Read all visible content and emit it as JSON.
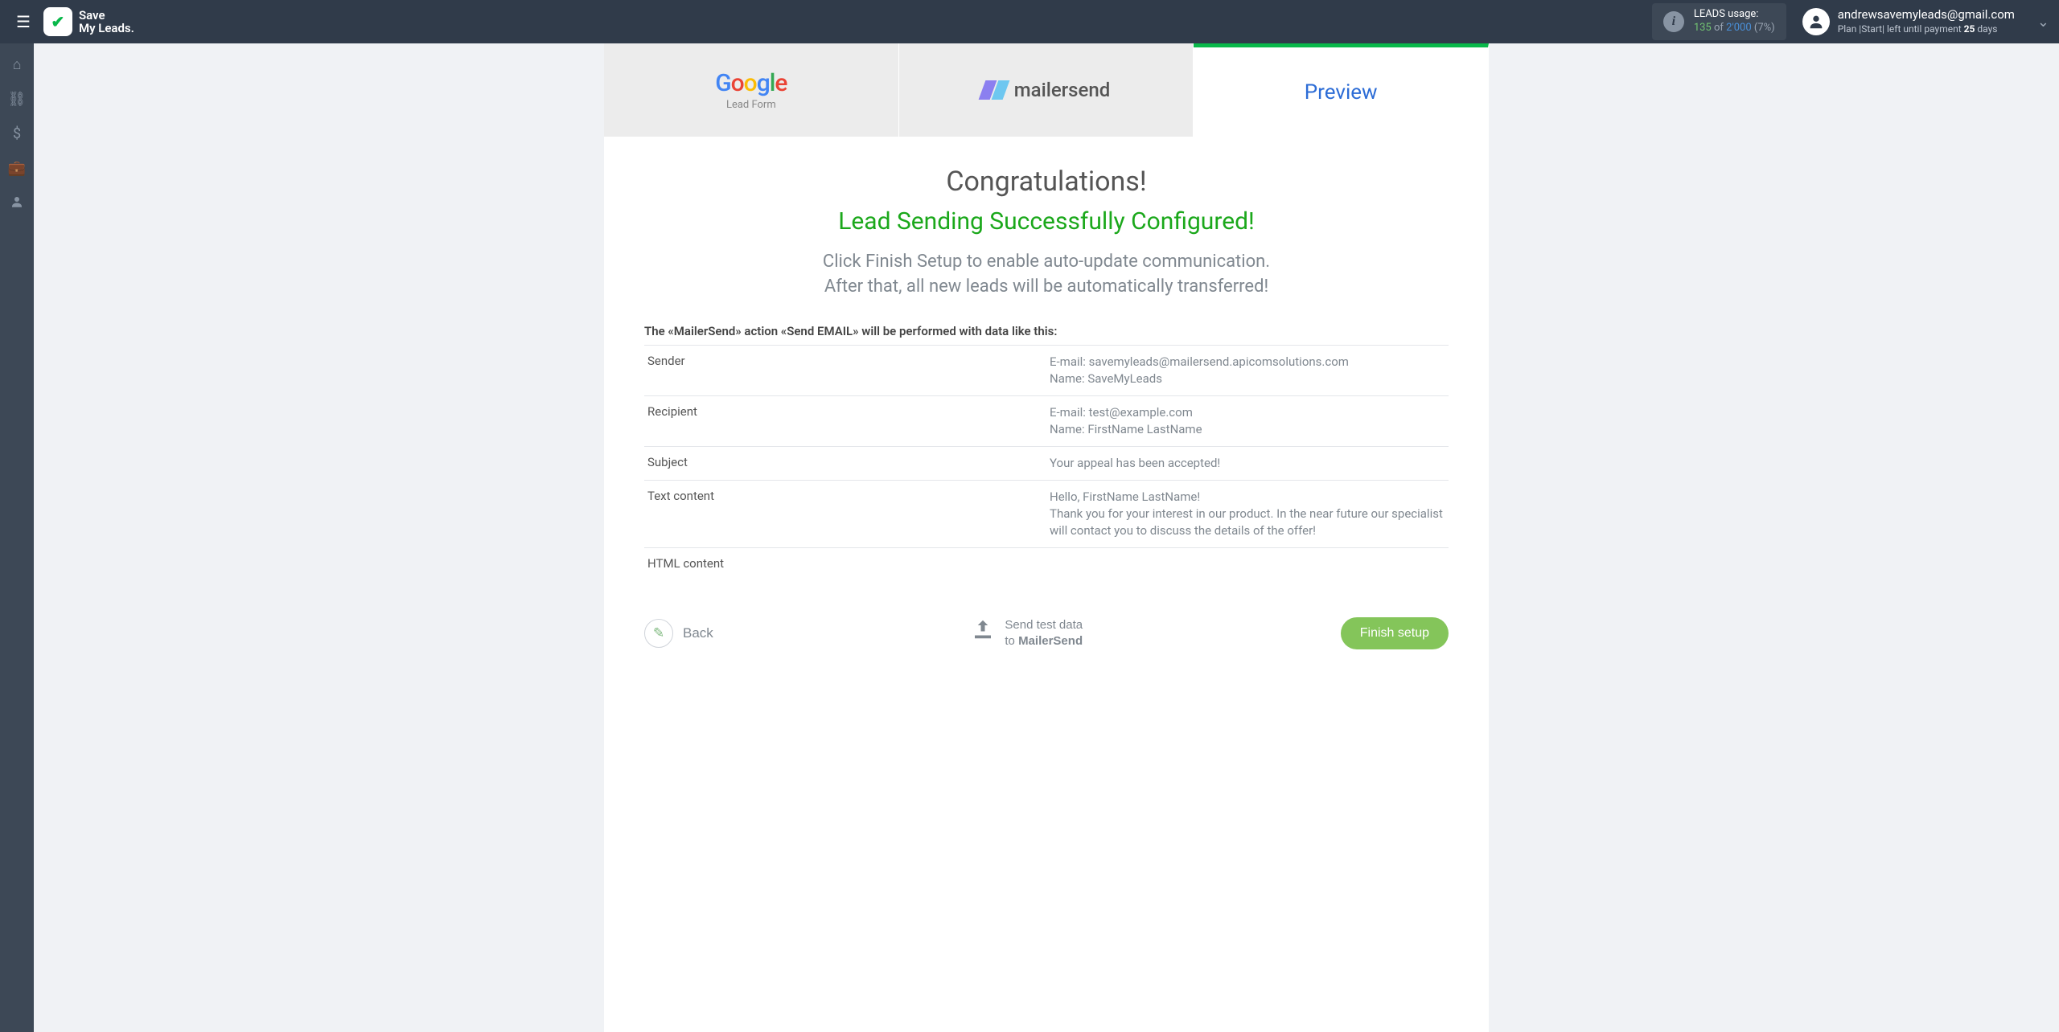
{
  "header": {
    "brand_line1": "Save",
    "brand_line2": "My Leads.",
    "usage": {
      "label": "LEADS usage:",
      "used": "135",
      "of": "of",
      "total": "2'000",
      "pct": "(7%)"
    },
    "user": {
      "email": "andrewsavemyleads@gmail.com",
      "plan_prefix": "Plan |Start| left until payment ",
      "days": "25",
      "plan_suffix": " days"
    }
  },
  "tabs": {
    "google_sub": "Lead Form",
    "mailersend": "mailersend",
    "preview": "Preview"
  },
  "content": {
    "congrats": "Congratulations!",
    "success": "Lead Sending Successfully Configured!",
    "instr1": "Click Finish Setup to enable auto-update communication.",
    "instr2": "After that, all new leads will be automatically transferred!"
  },
  "data": {
    "intro": "The «MailerSend» action «Send EMAIL» will be performed with data like this:",
    "rows": [
      {
        "label": "Sender",
        "value": "E-mail: savemyleads@mailersend.apicomsolutions.com\nName: SaveMyLeads"
      },
      {
        "label": "Recipient",
        "value": "E-mail: test@example.com\nName: FirstName LastName"
      },
      {
        "label": "Subject",
        "value": "Your appeal has been accepted!"
      },
      {
        "label": "Text content",
        "value": "Hello, FirstName LastName!\nThank you for your interest in our product. In the near future our specialist will contact you to discuss the details of the offer!"
      },
      {
        "label": "HTML content",
        "value": ""
      }
    ]
  },
  "footer": {
    "back": "Back",
    "send_test_line1": "Send test data",
    "send_test_line2_prefix": "to ",
    "send_test_line2_bold": "MailerSend",
    "finish": "Finish setup"
  }
}
